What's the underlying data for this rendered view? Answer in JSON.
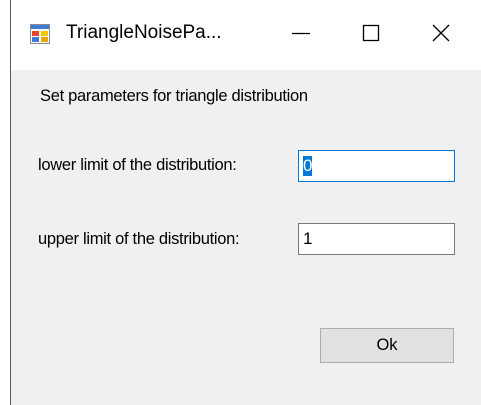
{
  "window": {
    "title": "TriangleNoisePa...",
    "icon": "windows-form-icon",
    "minimize_icon": "minimize-icon",
    "maximize_icon": "maximize-icon",
    "close_icon": "close-icon"
  },
  "form": {
    "header_label": "Set parameters for triangle distribution",
    "lower_label": "lower limit of the distribution:",
    "lower_value": "0",
    "upper_label": "upper limit of the distribution:",
    "upper_value": "1",
    "ok_label": "Ok"
  },
  "colors": {
    "client_background": "#f0f0f0",
    "focus_border": "#0078d7",
    "button_face": "#e1e1e1"
  }
}
